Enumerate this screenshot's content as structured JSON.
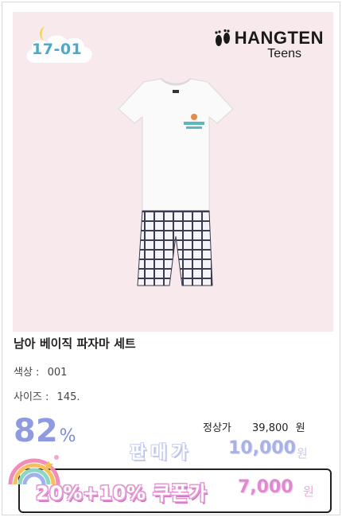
{
  "badge": {
    "code": "17-01"
  },
  "brand": {
    "name": "HANGTEN",
    "sub": "Teens"
  },
  "product": {
    "title": "남아 베이직 파자마 세트",
    "options": [
      {
        "key": "색상 :",
        "value": "001"
      },
      {
        "key": "사이즈 :",
        "value": "145."
      }
    ]
  },
  "pricing": {
    "discount_number": "82",
    "discount_sign": "%",
    "regular_label": "정상가",
    "regular_price": "39,800",
    "regular_unit": "원",
    "sale_label": "판매가",
    "sale_price": "10,000",
    "sale_unit": "원",
    "coupon_label": "20%+10% 쿠폰가",
    "coupon_price": "7,000",
    "coupon_unit": "원"
  },
  "colors": {
    "photo_bg": "#f7e9ec",
    "accent_blue": "#8f9be0",
    "accent_pink": "#e089d0",
    "accent_teal": "#3fb7b0"
  }
}
